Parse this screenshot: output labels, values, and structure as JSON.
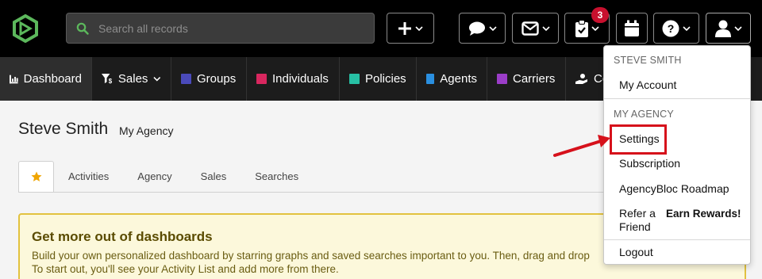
{
  "topbar": {
    "search_placeholder": "Search all records",
    "notification_count": "3",
    "buttons": {
      "add": "plus-icon",
      "messages": "chat-bubble-icon",
      "mail": "envelope-icon",
      "tasks": "clipboard-check-icon",
      "calendar": "calendar-icon",
      "help": "question-circle-icon",
      "user": "user-icon"
    }
  },
  "nav": {
    "items": [
      {
        "label": "Dashboard",
        "icon": "dashboard-icon"
      },
      {
        "label": "Sales",
        "icon": "funnel-icon"
      },
      {
        "label": "Groups",
        "color": "#4a4aba"
      },
      {
        "label": "Individuals",
        "color": "#d9275f"
      },
      {
        "label": "Policies",
        "color": "#27c0a4"
      },
      {
        "label": "Agents",
        "color": "#2a8fe0"
      },
      {
        "label": "Carriers",
        "color": "#9b3dc8"
      },
      {
        "label": "Co",
        "icon": "hand-coin-icon"
      }
    ]
  },
  "page": {
    "title": "Steve Smith",
    "subtitle": "My Agency",
    "tabs": [
      "Activities",
      "Agency",
      "Sales",
      "Searches"
    ]
  },
  "tip": {
    "heading": "Get more out of dashboards",
    "line1": "Build your own personalized dashboard by starring graphs and saved searches important to you. Then, drag and drop",
    "line2": "To start out, you'll see your Activity List and add more from there."
  },
  "dropdown": {
    "user_header": "STEVE SMITH",
    "my_account": "My Account",
    "agency_header": "MY AGENCY",
    "settings": "Settings",
    "subscription": "Subscription",
    "roadmap": "AgencyBloc Roadmap",
    "refer_line1": "Refer a",
    "refer_line2": "Friend",
    "earn_rewards": "Earn Rewards!",
    "logout": "Logout"
  },
  "colors": {
    "highlight": "#d6111b",
    "badge": "#c8102e",
    "logo": "#5cb85c"
  }
}
